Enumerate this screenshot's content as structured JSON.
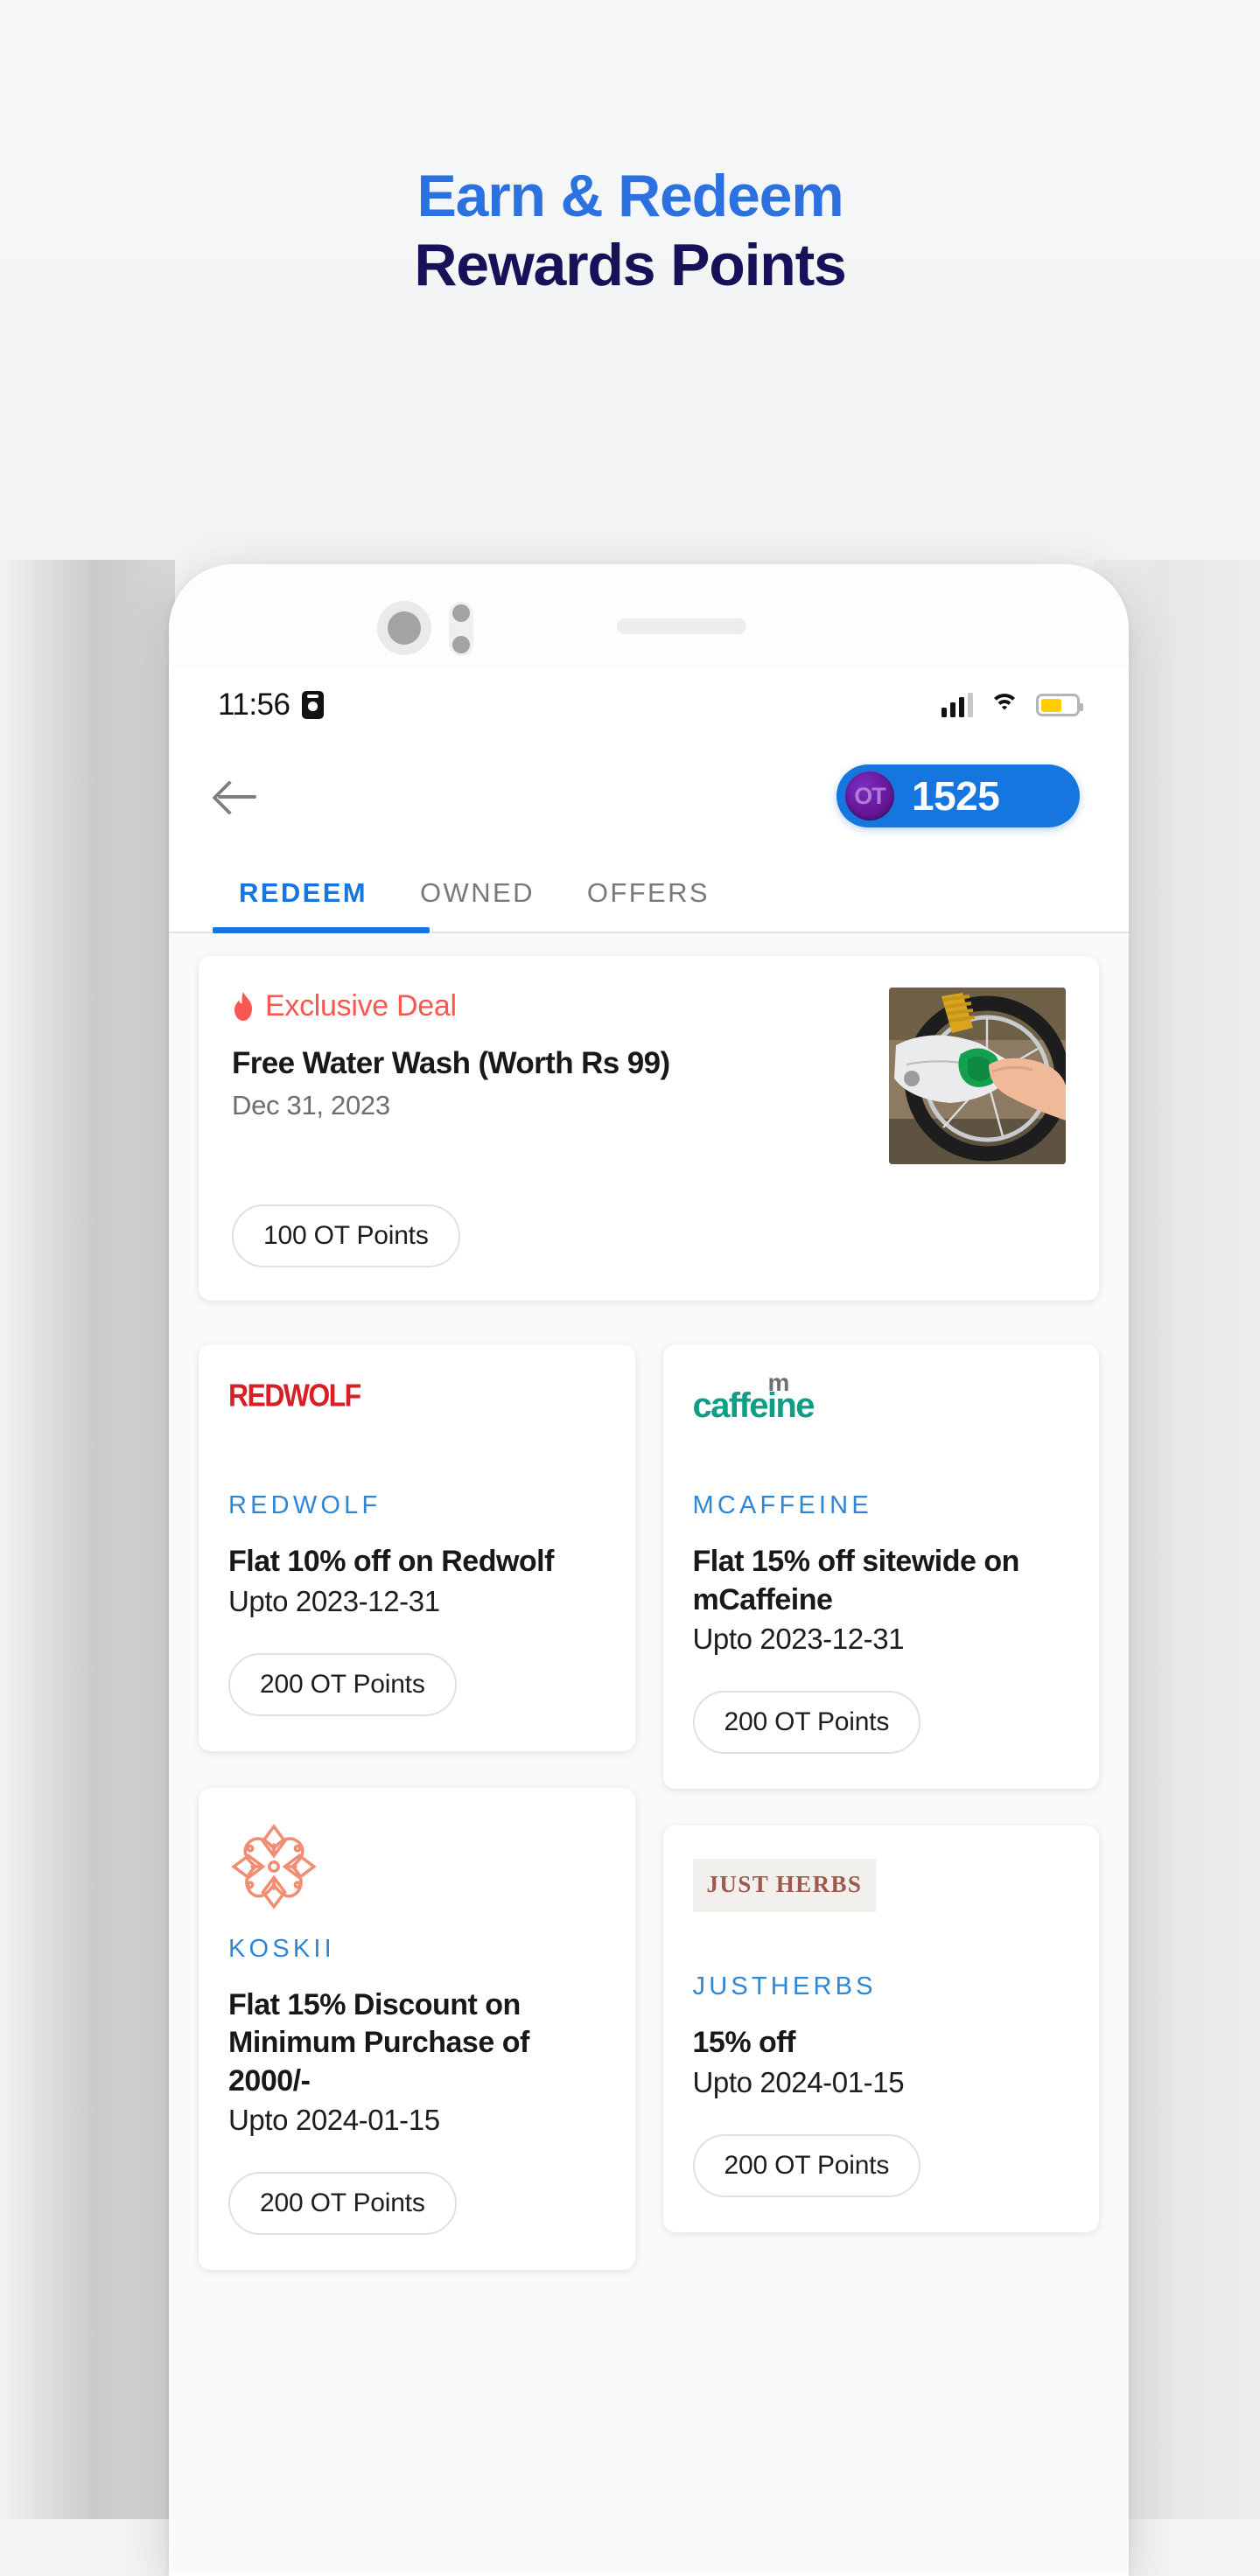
{
  "promo": {
    "line1": "Earn & Redeem",
    "line2": "Rewards Points",
    "line1_color": "#2b72e0",
    "line2_color": "#171159"
  },
  "status_bar": {
    "time": "11:56",
    "badge_icon": "contact-card-icon",
    "signal_icon": "cellular-signal-icon",
    "signal_bars_filled": 3,
    "signal_bars_total": 4,
    "wifi_icon": "wifi-icon",
    "battery_icon": "battery-icon",
    "battery_level_percent": 60,
    "battery_color": "#ffcc00"
  },
  "header": {
    "back_icon": "back-arrow-icon",
    "coin_icon_label": "OT",
    "points": "1525",
    "pill_color": "#1676e0",
    "coin_color": "#6a1a9f"
  },
  "tabs": {
    "active_index": 0,
    "items": [
      {
        "label": "REDEEM"
      },
      {
        "label": "OWNED"
      },
      {
        "label": "OFFERS"
      }
    ],
    "active_color": "#1676e0",
    "inactive_color": "#78797c"
  },
  "exclusive_deal": {
    "badge_icon": "flame-icon",
    "badge_label": "Exclusive Deal",
    "badge_color": "#f8584f",
    "title": "Free Water Wash (Worth Rs 99)",
    "date": "Dec 31, 2023",
    "points_chip": "100 OT Points",
    "thumbnail_alt": "motorcycle-wheel-being-washed-photo"
  },
  "offer_cards": [
    {
      "logo_icon": "redwolf-logo",
      "logo_text": "REDWOLF",
      "logo_color": "#d81f26",
      "brand": "REDWOLF",
      "title": "Flat 10% off on Redwolf",
      "valid": "Upto 2023-12-31",
      "points_chip": "200 OT Points"
    },
    {
      "logo_icon": "mcaffeine-logo",
      "logo_text": "caffeine",
      "logo_sup": "m",
      "logo_color": "#0e9e86",
      "brand": "MCAFFEINE",
      "title": "Flat 15% off sitewide on mCaffeine",
      "valid": "Upto 2023-12-31",
      "points_chip": "200 OT Points"
    },
    {
      "logo_icon": "koskii-ornament-logo",
      "logo_color": "#ef8e73",
      "brand": "KOSKII",
      "title": "Flat 15% Discount on Minimum Purchase of 2000/-",
      "valid": "Upto 2024-01-15",
      "points_chip": "200 OT Points"
    },
    {
      "logo_icon": "justherbs-logo",
      "logo_text": "JUST HERBS",
      "logo_color": "#9f5a4d",
      "brand": "JUSTHERBS",
      "title": "15% off",
      "valid": "Upto 2024-01-15",
      "points_chip": "200 OT Points"
    }
  ]
}
